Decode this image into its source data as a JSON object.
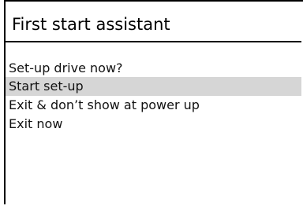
{
  "dialog": {
    "title": "First start assistant",
    "prompt": "Set-up drive now?",
    "options": [
      {
        "label": "Start set-up",
        "selected": true
      },
      {
        "label": "Exit & don’t show at power up",
        "selected": false
      },
      {
        "label": "Exit now",
        "selected": false
      }
    ]
  },
  "colors": {
    "background": "#ffffff",
    "text": "#111111",
    "selection_highlight": "#d6d6d6",
    "border": "#000000"
  }
}
